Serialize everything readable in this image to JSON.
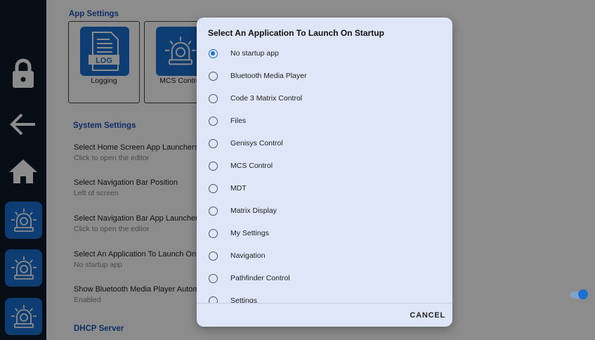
{
  "nav": {
    "items": [
      {
        "name": "lock-icon"
      },
      {
        "name": "back-arrow-icon"
      },
      {
        "name": "home-icon"
      },
      {
        "name": "beacon-app-icon"
      },
      {
        "name": "beacon-app-icon"
      },
      {
        "name": "beacon-app-icon"
      }
    ]
  },
  "app_settings": {
    "title": "App Settings",
    "tiles": [
      {
        "label": "Logging",
        "icon": "log-file-icon",
        "icon_text": "LOG"
      },
      {
        "label": "MCS Contro",
        "icon": "beacon-icon"
      }
    ]
  },
  "system_settings": {
    "title": "System Settings",
    "items": [
      {
        "title": "Select Home Screen App Launchers",
        "subtitle": "Click to open the editor"
      },
      {
        "title": "Select Navigation Bar Position",
        "subtitle": "Left of screen"
      },
      {
        "title": "Select Navigation Bar App Launchers",
        "subtitle": "Click to open the editor"
      },
      {
        "title": "Select An Application To Launch On S",
        "subtitle": "No startup app"
      },
      {
        "title": "Show Bluetooth Media Player Automa",
        "subtitle": "Enabled"
      }
    ]
  },
  "dhcp": {
    "title": "DHCP Server"
  },
  "toggle": {
    "state": "on",
    "color": "#1a6fd1"
  },
  "dialog": {
    "title": "Select An Application To Launch On Startup",
    "options": [
      {
        "label": "No startup app",
        "checked": true
      },
      {
        "label": "Bluetooth Media Player",
        "checked": false
      },
      {
        "label": "Code 3 Matrix Control",
        "checked": false
      },
      {
        "label": "Files",
        "checked": false
      },
      {
        "label": "Genisys Control",
        "checked": false
      },
      {
        "label": "MCS Control",
        "checked": false
      },
      {
        "label": "MDT",
        "checked": false
      },
      {
        "label": "Matrix Display",
        "checked": false
      },
      {
        "label": "My Settings",
        "checked": false
      },
      {
        "label": "Navigation",
        "checked": false
      },
      {
        "label": "Pathfinder Control",
        "checked": false
      },
      {
        "label": "Settings",
        "checked": false
      }
    ],
    "cancel_label": "CANCEL"
  },
  "colors": {
    "accent": "#1a6fd1",
    "nav_bg": "#0e1a29",
    "dialog_bg": "#dfe6f8",
    "section_title": "#1a55b8"
  }
}
